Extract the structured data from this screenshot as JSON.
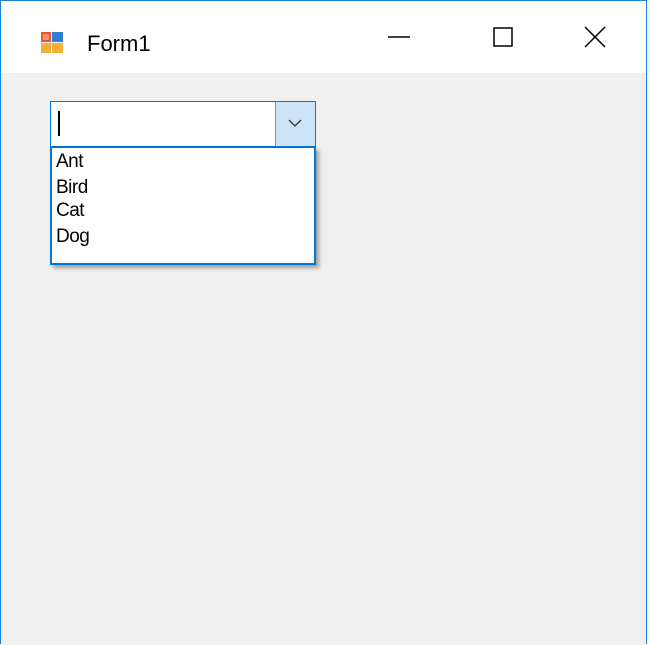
{
  "window": {
    "title": "Form1",
    "app_icon": "winforms-app-icon",
    "caption_buttons": {
      "minimize_icon": "minimize-icon",
      "maximize_icon": "maximize-icon",
      "close_icon": "close-icon"
    }
  },
  "combobox": {
    "value": "",
    "arrow_icon": "chevron-down-icon",
    "expanded": true,
    "items": [
      "Ant",
      "Bird",
      "Cat",
      "Dog"
    ]
  },
  "colors": {
    "accent": "#0078d7",
    "window_border": "#1883d7",
    "client_background": "#f0f0f0",
    "arrow_button_background": "#cce4f7"
  }
}
